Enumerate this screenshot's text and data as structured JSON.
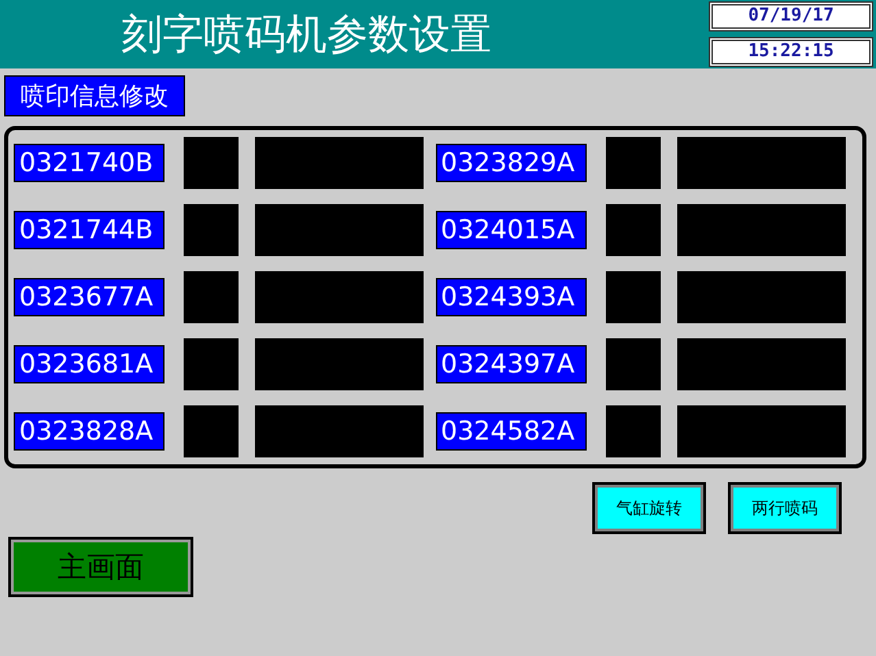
{
  "header": {
    "title": "刻字喷码机参数设置",
    "date": "07/19/17",
    "time": "15:22:15"
  },
  "section_label": "喷印信息修改",
  "columns": [
    {
      "items": [
        "0321740B",
        "0321744B",
        "0323677A",
        "0323681A",
        "0323828A"
      ]
    },
    {
      "items": [
        "0323829A",
        "0324015A",
        "0324393A",
        "0324397A",
        "0324582A"
      ]
    }
  ],
  "action_buttons": [
    "气缸旋转",
    "两行喷码"
  ],
  "main_button": "主画面"
}
